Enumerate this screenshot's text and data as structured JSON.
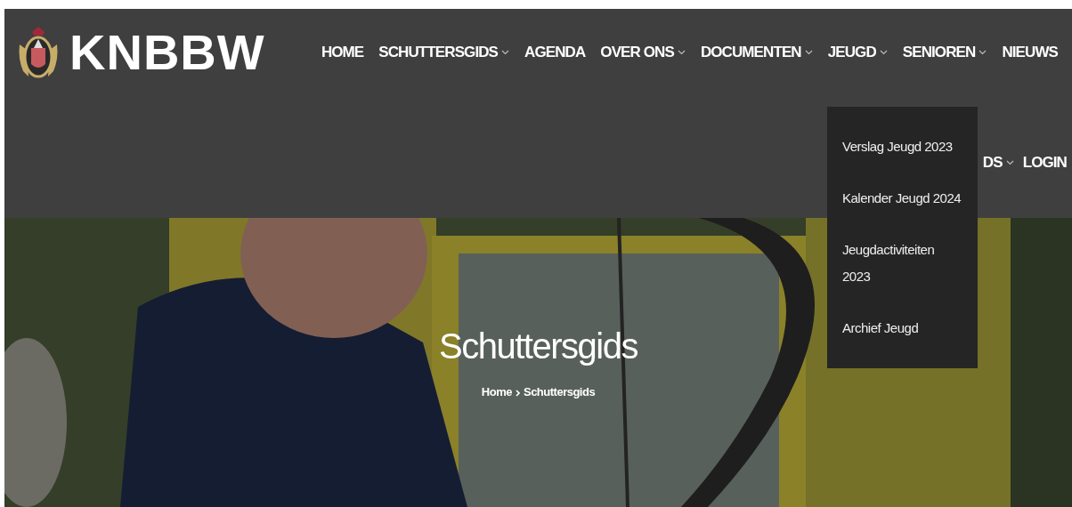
{
  "logo": {
    "text": "KNBBW"
  },
  "nav": [
    {
      "label": "HOME",
      "has_menu": false,
      "expanded": false
    },
    {
      "label": "SCHUTTERSGIDS",
      "has_menu": true,
      "expanded": false
    },
    {
      "label": "AGENDA",
      "has_menu": false,
      "expanded": false
    },
    {
      "label": "OVER ONS",
      "has_menu": true,
      "expanded": false
    },
    {
      "label": "DOCUMENTEN",
      "has_menu": true,
      "expanded": false
    },
    {
      "label": "JEUGD",
      "has_menu": true,
      "expanded": true,
      "submenu": [
        "Verslag Jeugd 2023",
        "Kalender Jeugd 2024",
        "Jeugdactiviteiten 2023",
        "Archief Jeugd"
      ]
    },
    {
      "label": "SENIOREN",
      "has_menu": true,
      "expanded": false
    },
    {
      "label": "NIEUWS",
      "has_menu": false,
      "expanded": false
    }
  ],
  "nav_row_2": [
    {
      "label": "DS",
      "has_menu": true
    },
    {
      "label": "LOGIN",
      "has_menu": false
    }
  ],
  "hero": {
    "kind": "picture",
    "title": "Schuttersgids",
    "breadcrumb": [
      {
        "label": "Home"
      },
      {
        "label": "Schuttersgids"
      }
    ]
  }
}
